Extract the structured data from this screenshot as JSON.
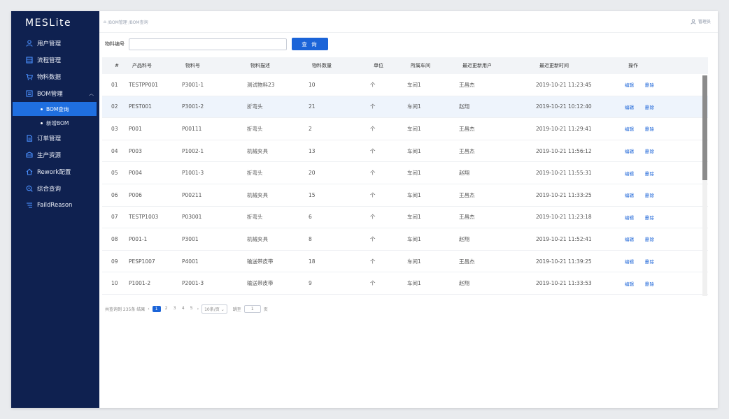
{
  "app": {
    "title": "MESLite"
  },
  "sidebar": {
    "items": [
      {
        "label": "用户管理",
        "icon": "user-icon"
      },
      {
        "label": "流程管理",
        "icon": "flow-icon"
      },
      {
        "label": "物料数据",
        "icon": "cart-icon"
      },
      {
        "label": "BOM管理",
        "icon": "bom-icon",
        "expanded": true,
        "children": [
          {
            "label": "BOM查询",
            "active": true
          },
          {
            "label": "新增BOM"
          }
        ]
      },
      {
        "label": "订单管理",
        "icon": "order-icon"
      },
      {
        "label": "生产资源",
        "icon": "resource-icon"
      },
      {
        "label": "Rework配置",
        "icon": "home-icon"
      },
      {
        "label": "综合查询",
        "icon": "search-icon"
      },
      {
        "label": "FaildReason",
        "icon": "list-icon"
      }
    ]
  },
  "header": {
    "breadcrumb": "/BOM管理 /BOM查询",
    "user": "管理员"
  },
  "search": {
    "label": "物料编号",
    "value": "",
    "button": "查 询"
  },
  "table": {
    "columns": [
      "#",
      "产品料号",
      "物料号",
      "物料描述",
      "物料数量",
      "单位",
      "所属车间",
      "最近更新用户",
      "最近更新时间",
      "操作"
    ],
    "rows": [
      [
        "01",
        "TESTPP001",
        "P3001-1",
        "测试物料23",
        "10",
        "个",
        "车间1",
        "王昌杰",
        "2019-10-21 11:23:45"
      ],
      [
        "02",
        "PEST001",
        "P3001-2",
        "折弯头",
        "21",
        "个",
        "车间1",
        "赵翔",
        "2019-10-21 10:12:40"
      ],
      [
        "03",
        "P001",
        "P00111",
        "折弯头",
        "2",
        "个",
        "车间1",
        "王昌杰",
        "2019-10-21 11:29:41"
      ],
      [
        "04",
        "P003",
        "P1002-1",
        "机械夹具",
        "13",
        "个",
        "车间1",
        "王昌杰",
        "2019-10-21 11:56:12"
      ],
      [
        "05",
        "P004",
        "P1001-3",
        "折弯头",
        "20",
        "个",
        "车间1",
        "赵翔",
        "2019-10-21 11:55:31"
      ],
      [
        "06",
        "P006",
        "P00211",
        "机械夹具",
        "15",
        "个",
        "车间1",
        "王昌杰",
        "2019-10-21 11:33:25"
      ],
      [
        "07",
        "TESTP1003",
        "P03001",
        "折弯头",
        "6",
        "个",
        "车间1",
        "王昌杰",
        "2019-10-21 11:23:18"
      ],
      [
        "08",
        "P001-1",
        "P3001",
        "机械夹具",
        "8",
        "个",
        "车间1",
        "赵翔",
        "2019-10-21 11:52:41"
      ],
      [
        "09",
        "PESP1007",
        "P4001",
        "输送带皮带",
        "18",
        "个",
        "车间1",
        "王昌杰",
        "2019-10-21 11:39:25"
      ],
      [
        "10",
        "P1001-2",
        "P2001-3",
        "输送带皮带",
        "9",
        "个",
        "车间1",
        "赵翔",
        "2019-10-21 11:33:53"
      ]
    ],
    "edit_label": "编辑",
    "delete_label": "删除",
    "highlight_row": 1
  },
  "pagination": {
    "total": "共查询到 235条 结果",
    "pages": [
      "1",
      "2",
      "3",
      "4",
      "5"
    ],
    "active": "1",
    "page_size": "10条/页",
    "jump_label": "跳至",
    "jump_value": "1",
    "page_suffix": "页"
  }
}
